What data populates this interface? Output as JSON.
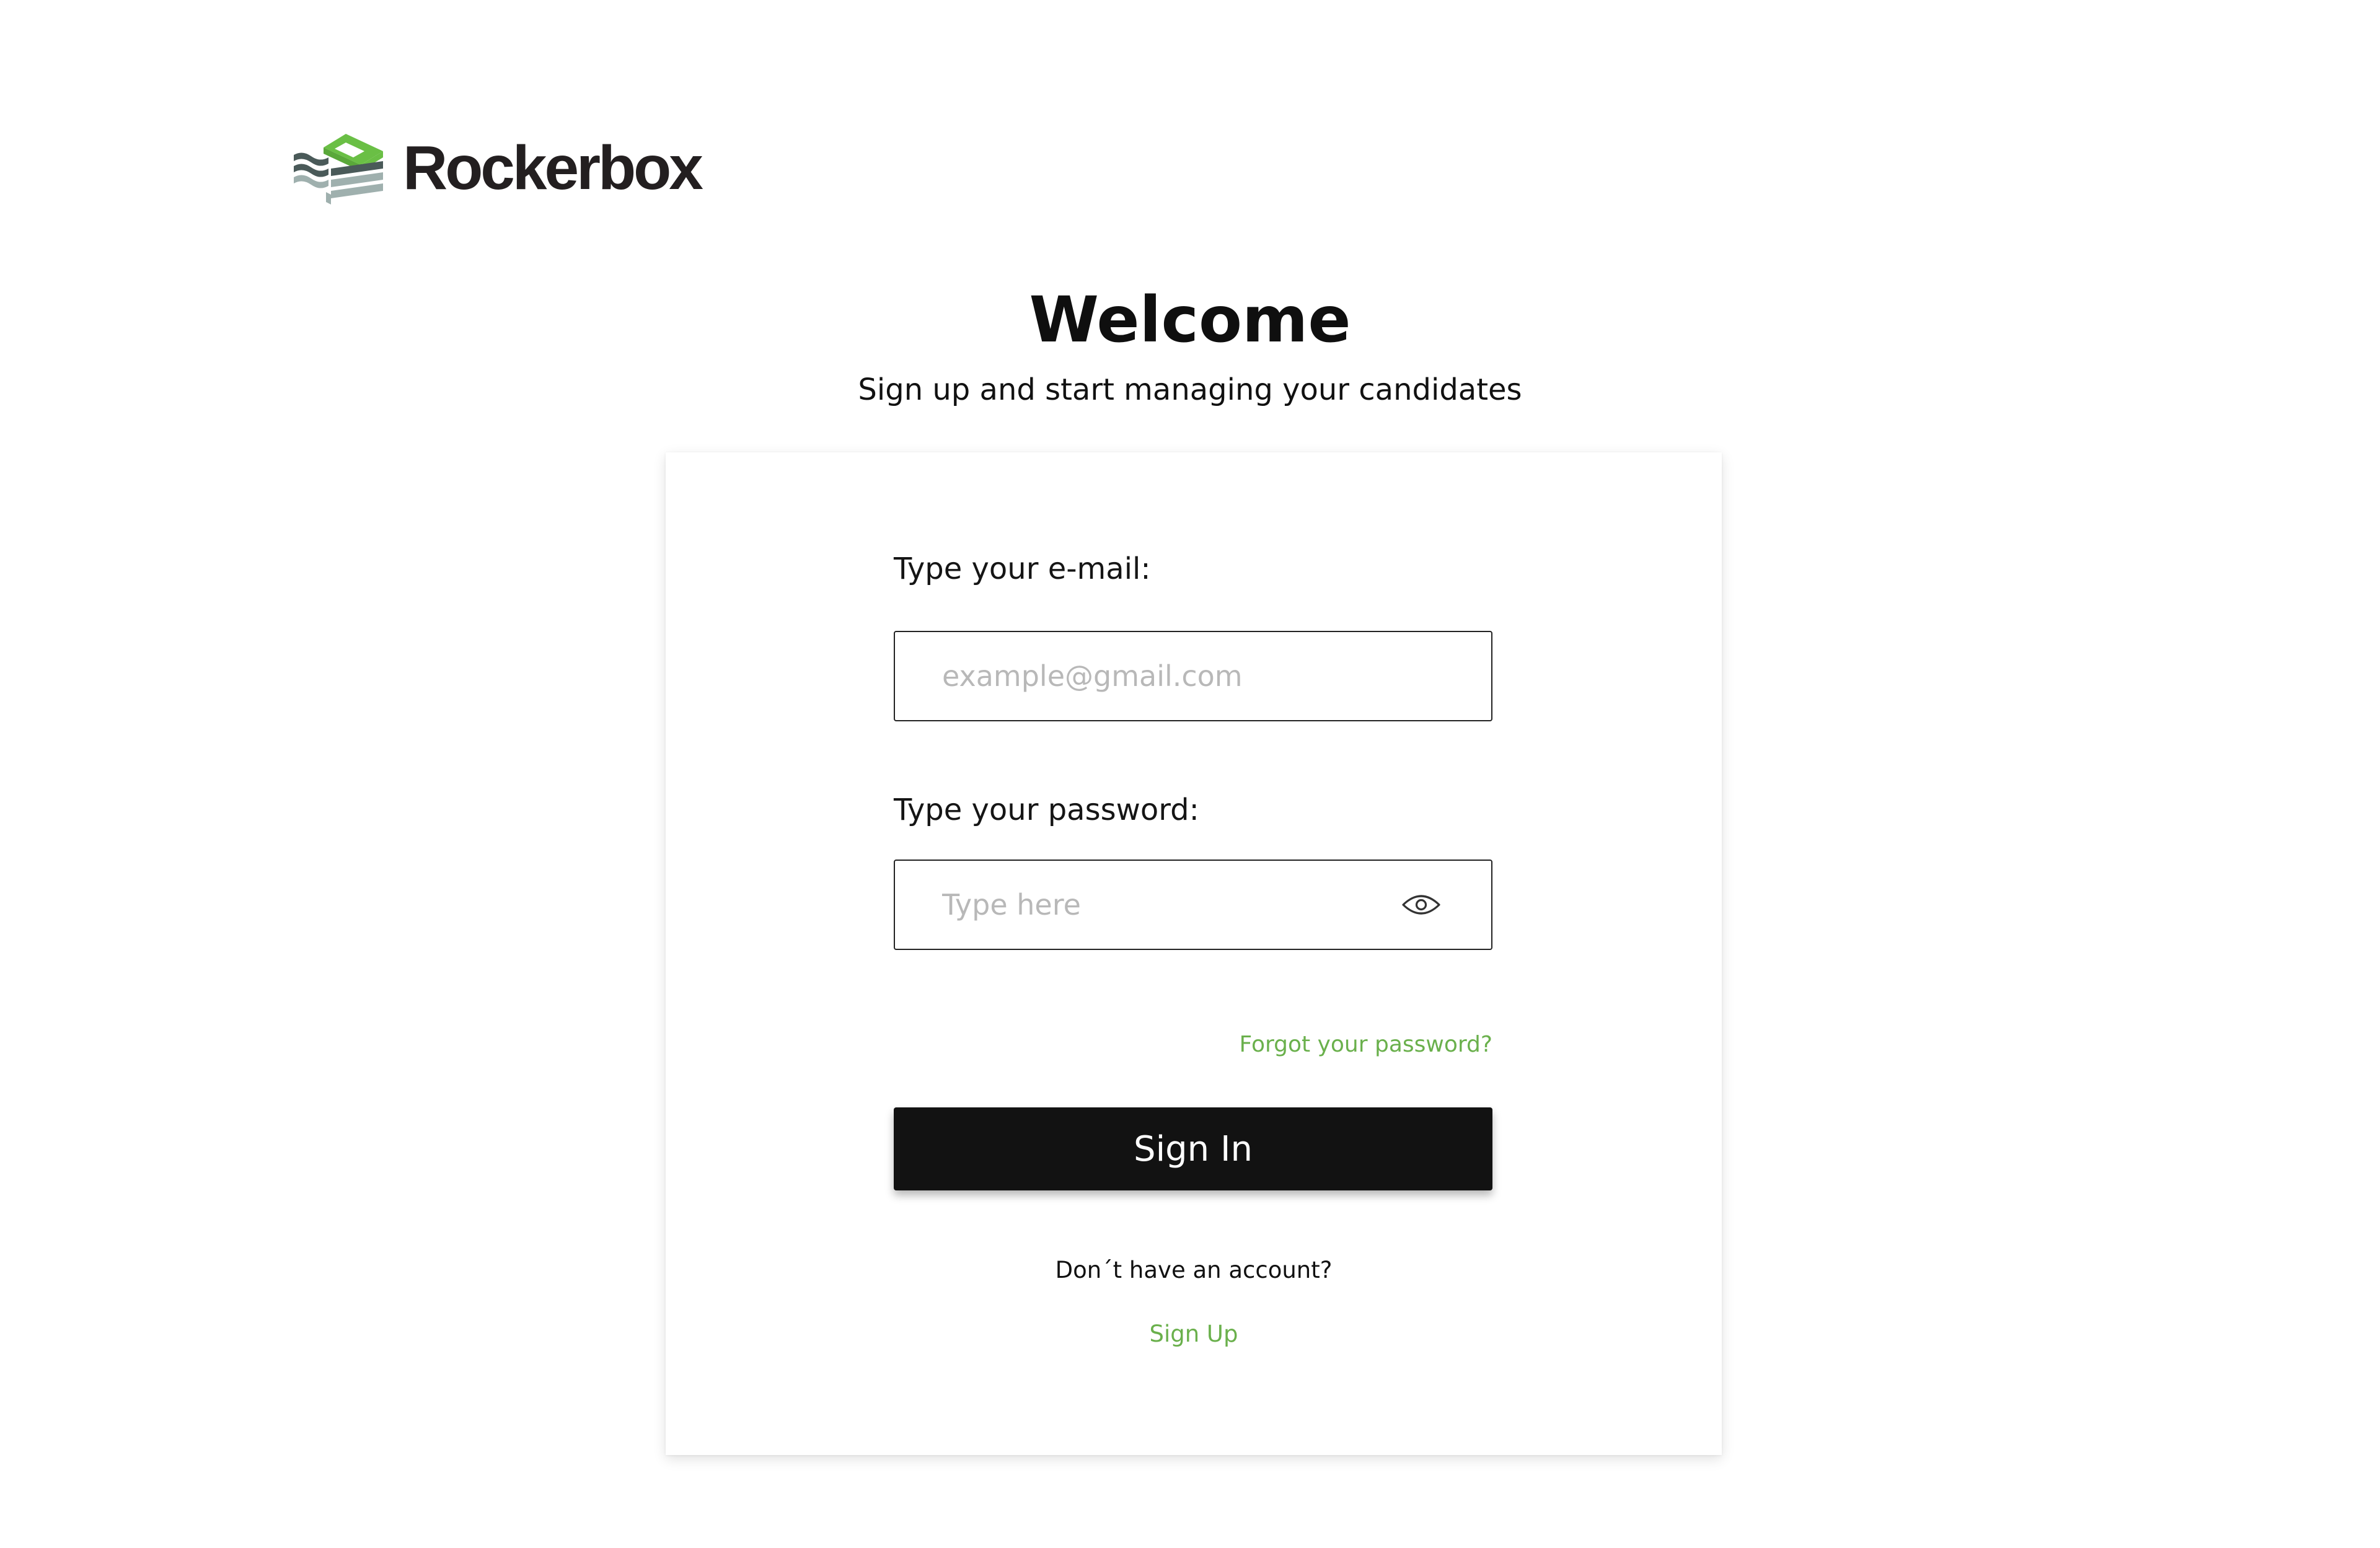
{
  "brand": {
    "name": "Rockerbox",
    "logo_icon": "rockerbox-stacked-layers-logo",
    "colors": {
      "green": "#6abf45",
      "dark": "#4a5a59",
      "gray": "#9fb0ae",
      "text": "#231f20"
    }
  },
  "header": {
    "title": "Welcome",
    "subtitle": "Sign up and start managing your candidates"
  },
  "form": {
    "email": {
      "label": "Type your e-mail:",
      "value": "",
      "placeholder": "example@gmail.com"
    },
    "password": {
      "label": "Type your password:",
      "value": "",
      "placeholder": "Type here",
      "toggle_icon": "eye-icon"
    },
    "forgot_label": "Forgot your password?",
    "submit_label": "Sign In"
  },
  "footer": {
    "no_account_text": "Don´t have an account?",
    "signup_label": "Sign Up"
  },
  "colors": {
    "accent": "#6ab04c",
    "button_bg": "#121212",
    "button_text": "#ffffff",
    "input_border": "#222222",
    "placeholder": "#b8b8b8"
  }
}
